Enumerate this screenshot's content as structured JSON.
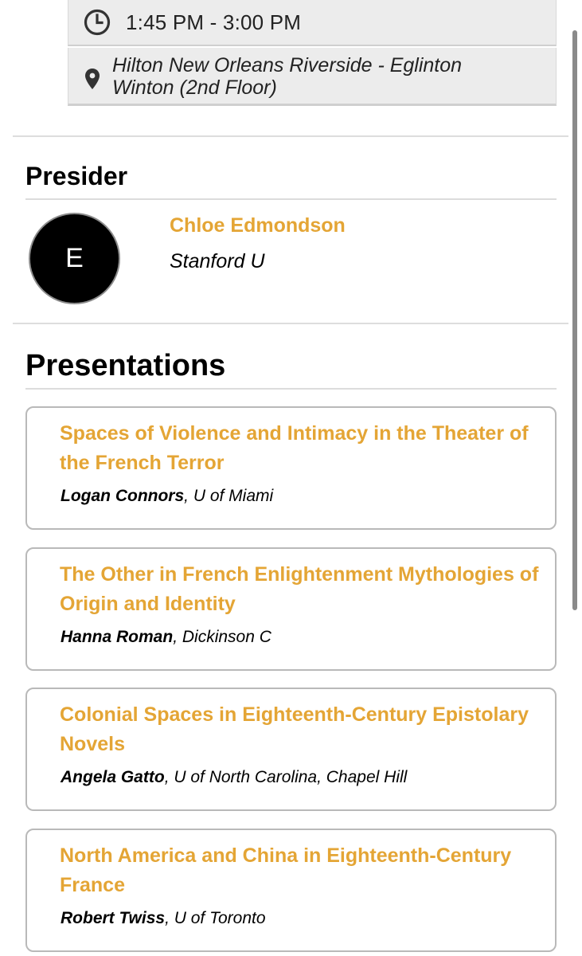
{
  "session": {
    "time": "1:45 PM - 3:00 PM",
    "location": "Hilton New Orleans Riverside - Eglinton Winton (2nd Floor)",
    "time_icon": "clock-icon",
    "location_icon": "map-pin-icon"
  },
  "presider": {
    "heading": "Presider",
    "avatar_letter": "E",
    "name": "Chloe Edmondson",
    "affiliation": "Stanford U"
  },
  "presentations": {
    "heading": "Presentations",
    "items": [
      {
        "title": "Spaces of Violence and Intimacy in the Theater of the French Terror",
        "author": "Logan Connors",
        "affiliation": ", U of Miami"
      },
      {
        "title": "The Other in French Enlightenment Mythologies of Origin and Identity",
        "author": "Hanna Roman",
        "affiliation": ", Dickinson C"
      },
      {
        "title": "Colonial Spaces in Eighteenth-Century Epistolary Novels",
        "author": "Angela Gatto",
        "affiliation": ", U of North Carolina, Chapel Hill"
      },
      {
        "title": "North America and China in Eighteenth-Century France",
        "author": "Robert Twiss",
        "affiliation": ", U of Toronto"
      }
    ]
  },
  "colors": {
    "accent": "#e4a535",
    "info_bg": "#ececec",
    "card_border": "#b9b9b9"
  }
}
